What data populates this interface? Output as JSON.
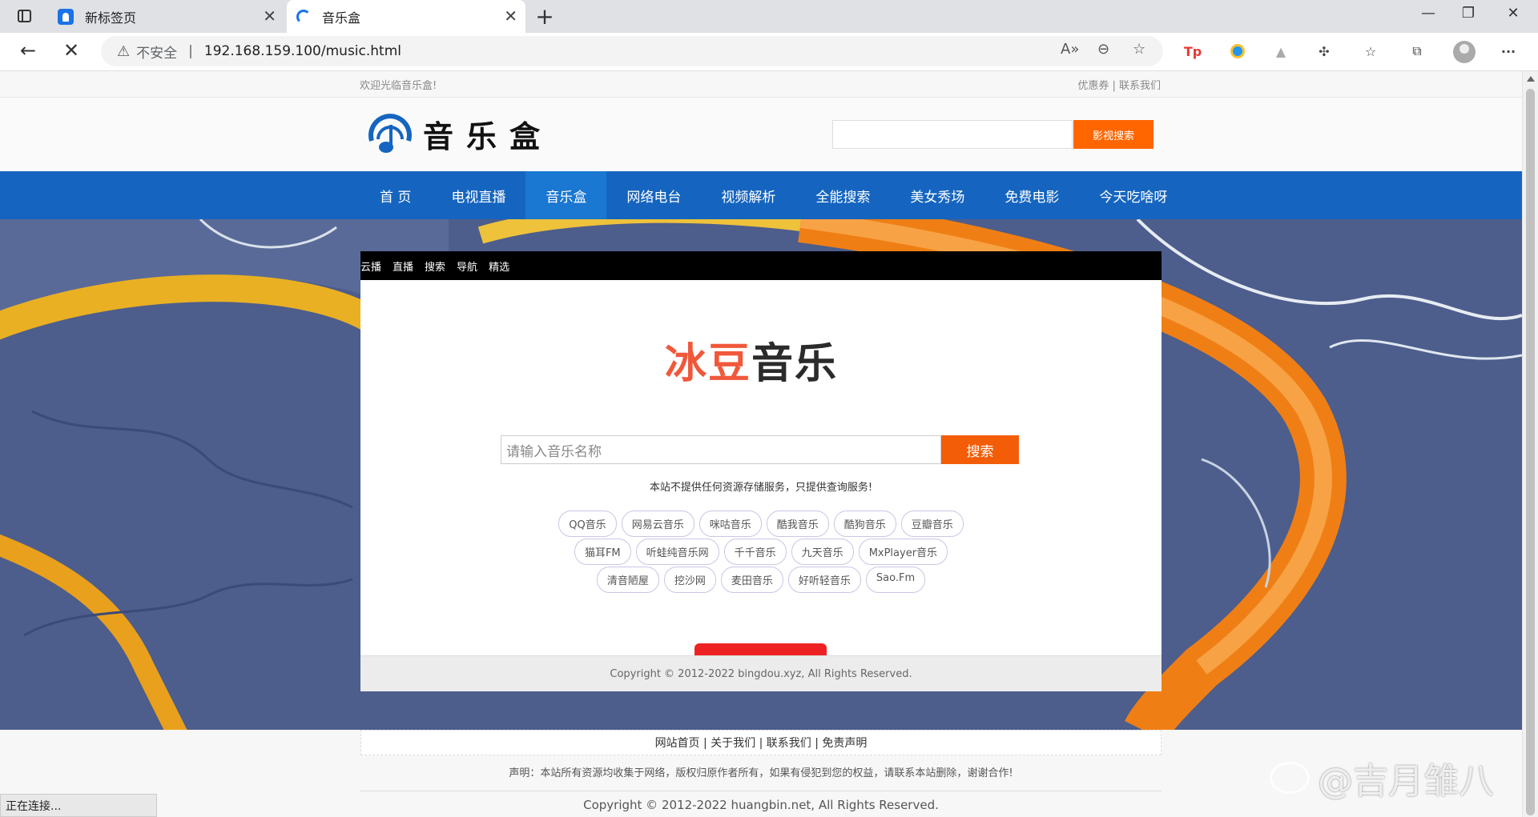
{
  "browser": {
    "tabs": [
      {
        "title": "新标签页",
        "active": false
      },
      {
        "title": "音乐盒",
        "active": true
      }
    ],
    "security_label": "不安全",
    "url": "192.168.159.100/music.html",
    "status_text": "正在连接..."
  },
  "site": {
    "welcome": "欢迎光临音乐盒!",
    "top_links": "优惠券 | 联系我们",
    "logo_text": "音乐盒",
    "search_button": "影视搜索",
    "nav": [
      "首 页",
      "电视直播",
      "音乐盒",
      "网络电台",
      "视频解析",
      "全能搜索",
      "美女秀场",
      "免费电影",
      "今天吃啥呀"
    ],
    "nav_active_index": 2
  },
  "player": {
    "tabs": [
      "云播",
      "直播",
      "搜索",
      "导航",
      "精选"
    ],
    "logo_part1": "冰豆",
    "logo_part2": "音乐",
    "search_placeholder": "请输入音乐名称",
    "search_button": "搜索",
    "notice": "本站不提供任何资源存储服务，只提供查询服务!",
    "sources_row1": [
      "QQ音乐",
      "网易云音乐",
      "咪咕音乐",
      "酷我音乐",
      "酷狗音乐",
      "豆瓣音乐"
    ],
    "sources_row2": [
      "猫耳FM",
      "听蛙纯音乐网",
      "千千音乐",
      "九天音乐",
      "MxPlayer音乐"
    ],
    "sources_row3": [
      "清音陋屋",
      "挖沙网",
      "麦田音乐",
      "好听轻音乐",
      "Sao.Fm"
    ],
    "footer": "Copyright © 2012-2022 bingdou.xyz, All Rights Reserved."
  },
  "footer": {
    "links": "网站首页 | 关于我们 | 联系我们 | 免责声明",
    "declaration": "声明：本站所有资源均收集于网络，版权归原作者所有，如果有侵犯到您的权益，请联系本站删除，谢谢合作!",
    "copyright": "Copyright © 2012-2022 huangbin.net, All Rights Reserved."
  },
  "watermark": "@吉月雏八",
  "colors": {
    "nav_blue": "#1565c0",
    "accent_orange": "#f60",
    "logo_red": "#f0583b"
  }
}
